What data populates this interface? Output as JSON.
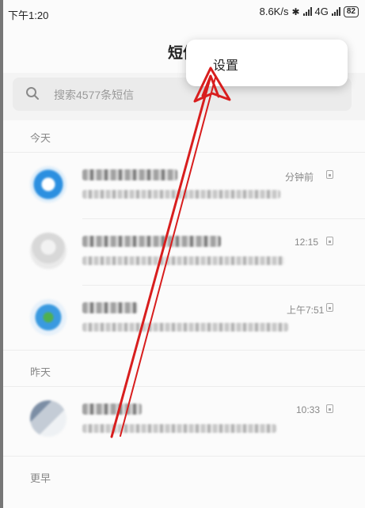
{
  "status_bar": {
    "time": "下午1:20",
    "speed": "8.6K/s",
    "network": "4G",
    "battery": "82"
  },
  "header": {
    "title": "短信"
  },
  "search": {
    "placeholder": "搜索4577条短信"
  },
  "sections": {
    "today": "今天",
    "earlier": "昨天",
    "older": "更早"
  },
  "conversations": [
    {
      "time": "分钟前",
      "avatar_color": "#2b8fe0"
    },
    {
      "time": "12:15",
      "avatar_color": "#d8d8d8"
    },
    {
      "time": "上午7:51",
      "avatar_color": "#3a9ae0"
    },
    {
      "time": "10:33",
      "avatar_color": "#c4ccd6"
    }
  ],
  "menu": {
    "settings": "设置"
  },
  "colors": {
    "annotation_arrow": "#d81e1e",
    "background": "#fbfbfb"
  }
}
